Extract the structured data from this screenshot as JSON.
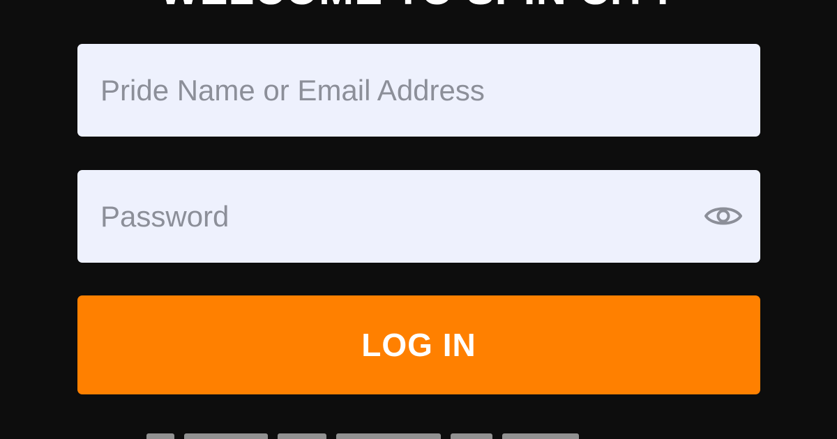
{
  "header": {
    "title": "WELCOME TO SPIN CITY"
  },
  "login_form": {
    "email": {
      "placeholder": "Pride Name or Email Address",
      "value": ""
    },
    "password": {
      "placeholder": "Password",
      "value": "",
      "toggle_icon": "eye-icon"
    },
    "submit_label": "LOG IN"
  },
  "colors": {
    "background": "#0d0d0d",
    "input_background": "#eef1fd",
    "placeholder_text": "#8c8f99",
    "accent": "#ff8000",
    "button_text": "#ffffff"
  }
}
